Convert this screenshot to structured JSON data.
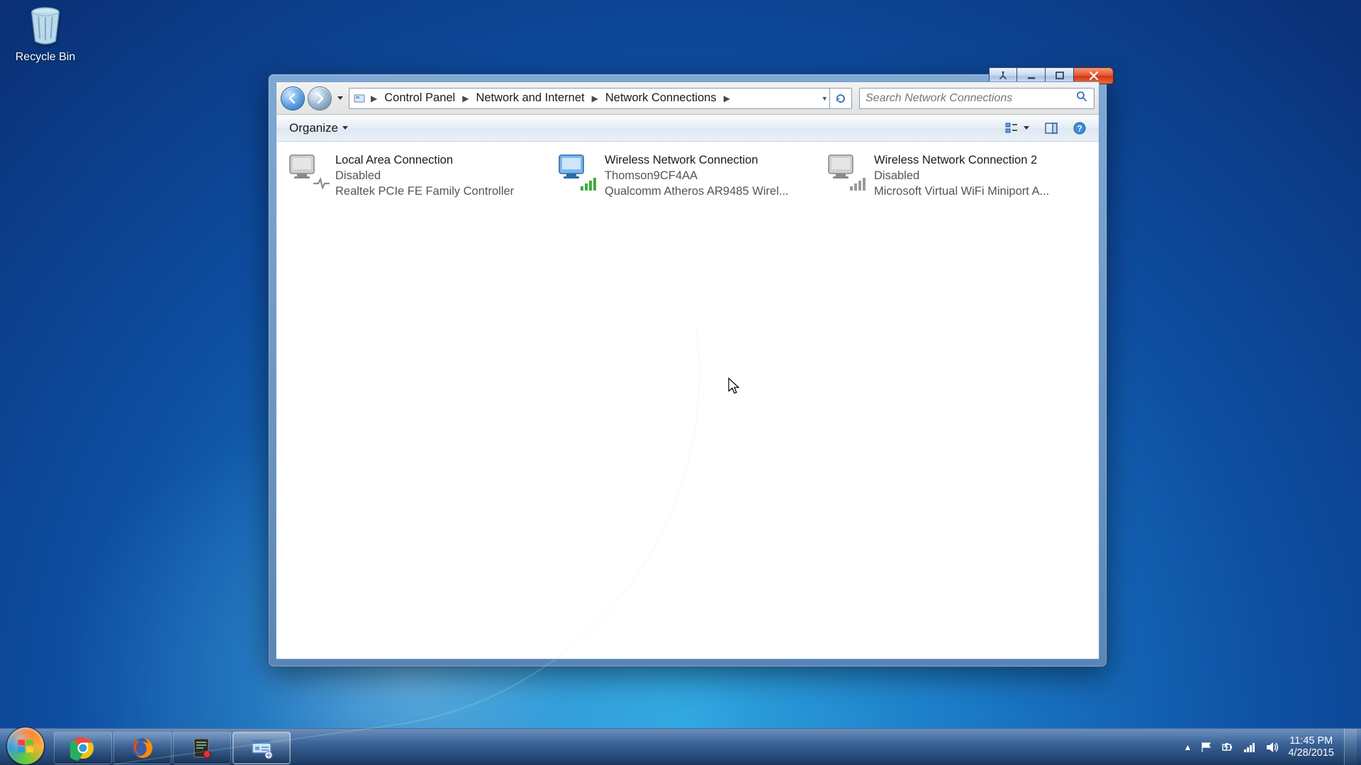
{
  "desktop": {
    "recycle_bin_label": "Recycle Bin"
  },
  "window": {
    "breadcrumb": {
      "root": "Control Panel",
      "mid": "Network and Internet",
      "leaf": "Network Connections"
    },
    "search_placeholder": "Search Network Connections",
    "toolbar": {
      "organize_label": "Organize"
    },
    "connections": [
      {
        "name": "Local Area Connection",
        "status": "Disabled",
        "adapter": "Realtek PCIe FE Family Controller",
        "enabled": false,
        "kind": "wired"
      },
      {
        "name": "Wireless Network Connection",
        "status": "Thomson9CF4AA",
        "adapter": "Qualcomm Atheros AR9485 Wirel...",
        "enabled": true,
        "kind": "wifi"
      },
      {
        "name": "Wireless Network Connection 2",
        "status": "Disabled",
        "adapter": "Microsoft Virtual WiFi Miniport A...",
        "enabled": false,
        "kind": "wifi"
      }
    ]
  },
  "taskbar": {
    "time": "11:45 PM",
    "date": "4/28/2015"
  }
}
